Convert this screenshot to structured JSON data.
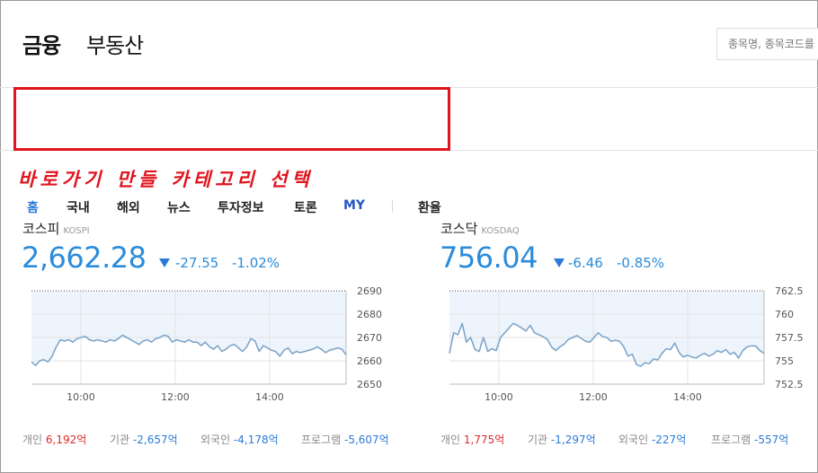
{
  "header": {
    "brand": "금융",
    "brand_secondary": "부동산",
    "search_placeholder": "종목명, 종목코드를"
  },
  "nav": {
    "items": [
      {
        "label": "홈",
        "state": "active"
      },
      {
        "label": "국내"
      },
      {
        "label": "해외"
      },
      {
        "label": "뉴스"
      },
      {
        "label": "투자정보"
      },
      {
        "label": "토론"
      },
      {
        "label": "MY"
      },
      {
        "label": "환율"
      }
    ]
  },
  "annotation": "바로가기 만들 카테고리 선택",
  "colors": {
    "accent": "#2a7ad9",
    "highlight_box": "#e0141e",
    "up": "#e02a2a",
    "down": "#2a7ad9",
    "line": "#7fa6c9",
    "area": "#edf4fc"
  },
  "indices": [
    {
      "name": "코스피",
      "sub": "KOSPI",
      "value": "2,662.28",
      "direction": "down",
      "change": "-27.55",
      "pct": "-1.02%",
      "chart_data": {
        "type": "line",
        "x_ticks": [
          "10:00",
          "12:00",
          "14:00"
        ],
        "y_ticks": [
          "2690",
          "2680",
          "2670",
          "2660",
          "2650"
        ],
        "ylim": [
          2650,
          2690
        ],
        "y_top_dotted": 2690,
        "y": [
          2659.5,
          2658,
          2660,
          2660.5,
          2659.5,
          2662,
          2666,
          2669,
          2668.5,
          2669,
          2668,
          2669.5,
          2670,
          2670.5,
          2669,
          2668.5,
          2669,
          2668.5,
          2668,
          2669,
          2668.5,
          2669.5,
          2671,
          2670,
          2669,
          2668,
          2667,
          2668.5,
          2669,
          2668,
          2669.5,
          2670,
          2671,
          2670.5,
          2668,
          2669,
          2668.5,
          2668,
          2669,
          2668,
          2668,
          2666.5,
          2668,
          2666,
          2665,
          2666.5,
          2664,
          2665,
          2666.5,
          2667,
          2665.5,
          2664,
          2666,
          2669.5,
          2668.5,
          2664,
          2666.5,
          2665.5,
          2664.5,
          2664,
          2662,
          2664.5,
          2665.5,
          2663,
          2664,
          2663.5,
          2664,
          2664.5,
          2665,
          2666,
          2665,
          2663.5,
          2664.5,
          2665,
          2665.5,
          2665,
          2662.5
        ]
      },
      "stats": [
        {
          "label": "개인",
          "value": "6,192억",
          "dir": "up"
        },
        {
          "label": "기관",
          "value": "-2,657억",
          "dir": "down"
        },
        {
          "label": "외국인",
          "value": "-4,178억",
          "dir": "down"
        },
        {
          "label": "프로그램",
          "value": "-5,607억",
          "dir": "down"
        }
      ]
    },
    {
      "name": "코스닥",
      "sub": "KOSDAQ",
      "value": "756.04",
      "direction": "down",
      "change": "-6.46",
      "pct": "-0.85%",
      "chart_data": {
        "type": "line",
        "x_ticks": [
          "10:00",
          "12:00",
          "14:00"
        ],
        "y_ticks": [
          "762.5",
          "760",
          "757.5",
          "755",
          "752.5"
        ],
        "ylim": [
          752.5,
          762.5
        ],
        "y_top_dotted": 762.5,
        "y": [
          755.8,
          758,
          757.8,
          759,
          757,
          757.5,
          756.2,
          756,
          757.5,
          756,
          756.3,
          756.1,
          757.5,
          758,
          758.5,
          759,
          758.8,
          758.5,
          758.2,
          758.8,
          758,
          757.8,
          757.6,
          757.3,
          756.5,
          756.1,
          756.5,
          756.8,
          757.3,
          757.5,
          757.7,
          757.4,
          757.1,
          757,
          757.5,
          758,
          757.6,
          757.5,
          757.1,
          757.2,
          757.1,
          756.5,
          755.5,
          755.7,
          754.6,
          754.4,
          754.8,
          754.7,
          755.2,
          755.1,
          755.8,
          756.3,
          756.2,
          756.9,
          755.9,
          755.4,
          755.6,
          755.4,
          755.3,
          755.6,
          755.8,
          755.5,
          755.7,
          756.1,
          755.9,
          756.2,
          755.7,
          755.9,
          755.3,
          756.1,
          756.5,
          756.6,
          756.6,
          756.1,
          755.8
        ]
      },
      "stats": [
        {
          "label": "개인",
          "value": "1,775억",
          "dir": "up"
        },
        {
          "label": "기관",
          "value": "-1,297억",
          "dir": "down"
        },
        {
          "label": "외국인",
          "value": "-227억",
          "dir": "down"
        },
        {
          "label": "프로그램",
          "value": "-557억",
          "dir": "down"
        }
      ]
    }
  ]
}
